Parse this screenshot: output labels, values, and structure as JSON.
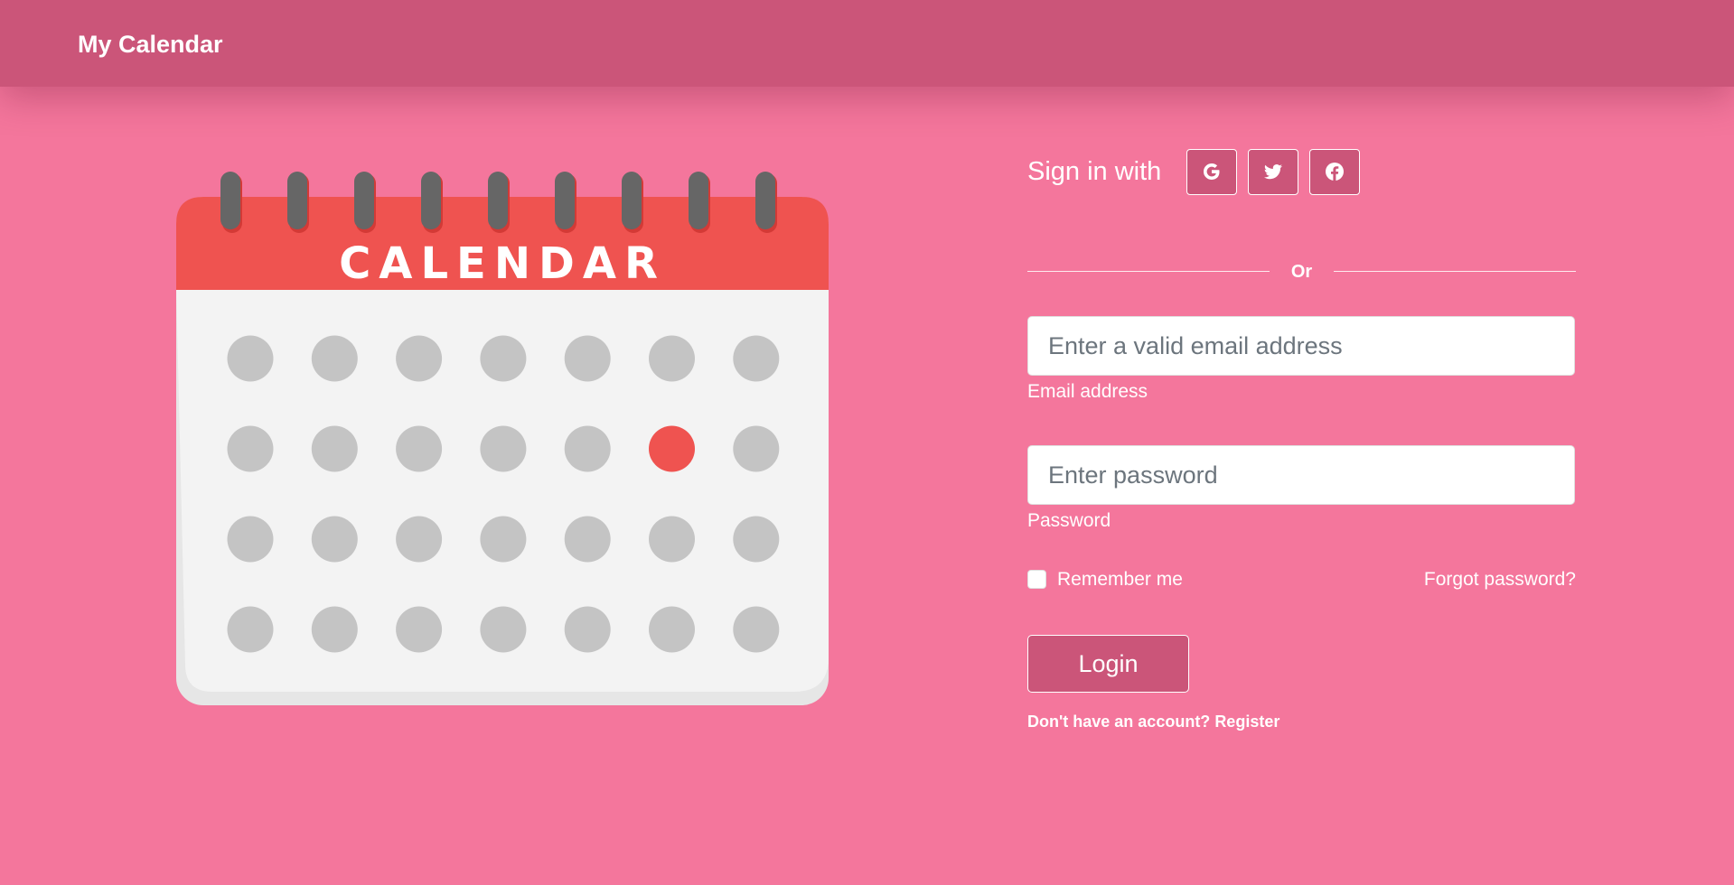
{
  "navbar": {
    "brand": "My Calendar"
  },
  "illustration": {
    "header_text": "CALENDAR",
    "grid": {
      "rows": 4,
      "cols": 7,
      "highlighted": {
        "row": 2,
        "col": 6
      }
    },
    "colors": {
      "header": "#ef5350",
      "body": "#f3f3f3",
      "dot": "#c4c4c4",
      "highlight": "#ef5350",
      "ring": "#666666"
    }
  },
  "social": {
    "label": "Sign in with",
    "buttons": [
      {
        "name": "google",
        "icon": "google-icon"
      },
      {
        "name": "twitter",
        "icon": "twitter-icon"
      },
      {
        "name": "facebook",
        "icon": "facebook-icon"
      }
    ]
  },
  "divider": {
    "text": "Or"
  },
  "form": {
    "email": {
      "placeholder": "Enter a valid email address",
      "value": "",
      "label": "Email address"
    },
    "password": {
      "placeholder": "Enter password",
      "value": "",
      "label": "Password"
    },
    "remember_label": "Remember me",
    "forgot_label": "Forgot password?",
    "login_label": "Login",
    "register_prompt": "Don't have an account? ",
    "register_link": "Register"
  },
  "colors": {
    "background": "#f4769c",
    "navbar": "#cb5579",
    "button": "#cb5579"
  }
}
